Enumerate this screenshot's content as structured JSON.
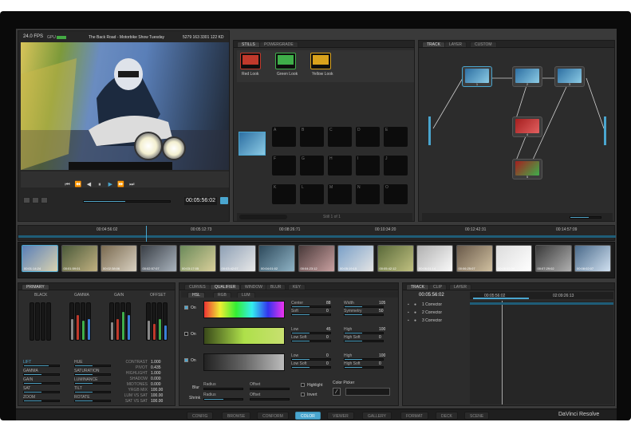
{
  "app": {
    "brand": "DaVinci Resolve"
  },
  "viewer": {
    "fps": "24.0 FPS",
    "gpu_label": "GPU",
    "clip_title": "The Back Road - Motorbike Show Tuesday",
    "clip_info": "5279 163 3301 122 KD",
    "timecode": "00:05:56:02"
  },
  "stills": {
    "tabs": [
      "STILLS",
      "POWERGRADE"
    ],
    "memories": [
      {
        "label": "Red Look",
        "color": "#c0392b"
      },
      {
        "label": "Green Look",
        "color": "#3fae4a"
      },
      {
        "label": "Yellow Look",
        "color": "#d9a21c"
      }
    ],
    "slots": [
      "A",
      "B",
      "C",
      "D",
      "E",
      "F",
      "G",
      "H",
      "I",
      "J",
      "K",
      "L",
      "M",
      "N",
      "O"
    ],
    "status": "Still 1 of 1"
  },
  "nodes": {
    "tabs": [
      "TRACK",
      "LAYER",
      "CUSTOM"
    ],
    "items": [
      "1",
      "2",
      "3",
      "4",
      "5"
    ]
  },
  "timeline": {
    "ticks": [
      "00:04:56:02",
      "00:05:12:73",
      "00:08:26:71",
      "00:10:34:20",
      "00:12:42:31",
      "00:14:57:09"
    ],
    "thumbs": [
      {
        "tc": "00:01:14:24"
      },
      {
        "tc": "00:01:59:01"
      },
      {
        "tc": "00:02:38:06"
      },
      {
        "tc": "00:02:57:07"
      },
      {
        "tc": "00:03:17:05"
      },
      {
        "tc": "00:03:42:07"
      },
      {
        "tc": "00:04:01:02"
      },
      {
        "tc": "00:04:23:12"
      },
      {
        "tc": "00:05:19:15"
      },
      {
        "tc": "00:05:42:12"
      },
      {
        "tc": "00:06:01:14"
      },
      {
        "tc": "00:06:25:07"
      },
      {
        "tc": "00:06:53:09"
      },
      {
        "tc": "00:07:29:02"
      },
      {
        "tc": "00:08:02:07"
      }
    ]
  },
  "primary": {
    "header": "PRIMARY",
    "groups": [
      "BLACK",
      "GAMMA",
      "GAIN",
      "OFFSET"
    ],
    "left_params": [
      "LIFT",
      "GAMMA",
      "GAIN",
      "SAT",
      "ZOOM"
    ],
    "mid_params": [
      "HUE",
      "SATURATION",
      "LUMINANCE",
      "TILT",
      "ROTATE"
    ],
    "right_labels": [
      "CONTRAST",
      "PIVOT",
      "HIGHLIGHT",
      "SHADOW",
      "MIDTONES",
      "YRGB MIX",
      "LUM VS SAT",
      "SAT VS SAT"
    ],
    "right_values": [
      "1.000",
      "0.435",
      "1.000",
      "0.000",
      "0.000",
      "100.00",
      "100.00",
      "100.00"
    ]
  },
  "qualifier": {
    "tabs": [
      "CURVES",
      "QUALIFIER",
      "WINDOW",
      "BLUR",
      "KEY"
    ],
    "subtabs": [
      "HSL",
      "RGB",
      "LUM"
    ],
    "on_label": "On",
    "rows": [
      {
        "p1": "Center",
        "v1": "88",
        "p2": "Width",
        "v2": "105",
        "p3": "Soft",
        "v3": "0",
        "p4": "Symmetry",
        "v4": "50"
      },
      {
        "p1": "Low",
        "v1": "45",
        "p2": "High",
        "v2": "100",
        "p3": "Low Soft",
        "v3": "0",
        "p4": "High Soft",
        "v4": "0"
      },
      {
        "p1": "Low",
        "v1": "0",
        "p2": "High",
        "v2": "100",
        "p3": "Low Soft",
        "v3": "0",
        "p4": "High Soft",
        "v4": "0"
      }
    ],
    "blur_label": "Blur",
    "shrink_label": "Shrink",
    "radius_label": "Radius",
    "offset_label": "Offset",
    "highlight_label": "Highlight",
    "invert_label": "Invert",
    "picker_label": "Color Picker"
  },
  "track": {
    "tabs": [
      "TRACK",
      "CLIP",
      "LAYER"
    ],
    "timecode": "00:05:56:02",
    "tc_a": "00:05:56:02",
    "tc_b": "02:09:26:13",
    "rows": [
      "1 Corrector",
      "2 Corrector",
      "3 Corrector"
    ]
  },
  "bottom_nav": [
    "CONFIG",
    "BROWSE",
    "CONFORM",
    "COLOR",
    "VIEWER",
    "GALLERY",
    "FORMAT",
    "DECK",
    "SCENE"
  ],
  "active_nav": "COLOR",
  "colors": {
    "accent": "#4aa6cf",
    "panel": "#2c2c2c"
  }
}
